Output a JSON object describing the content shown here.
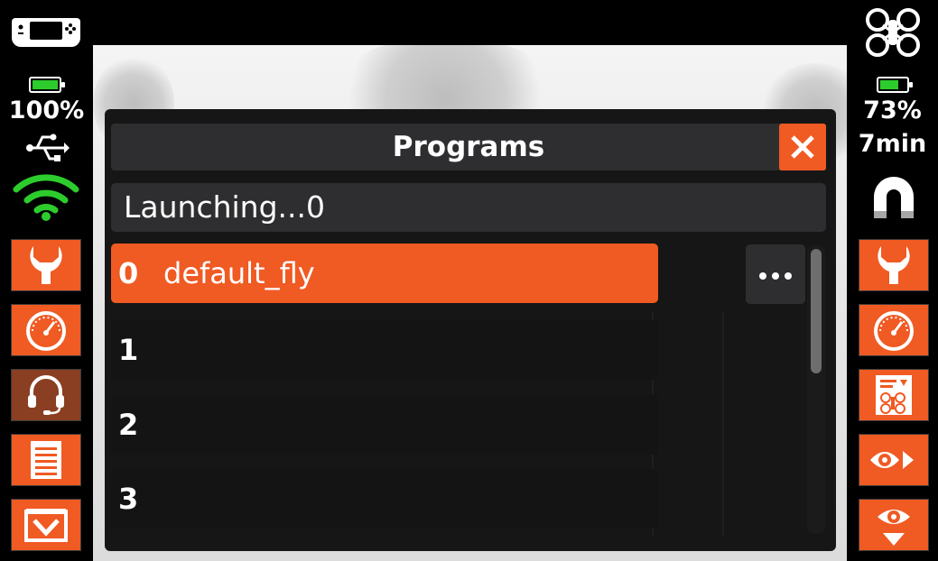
{
  "left_bar": {
    "controller_icon": "gamepad-icon",
    "battery_percent": "100%",
    "battery_level": 1.0,
    "usb_icon": "usb-icon",
    "wifi_icon": "wifi-icon",
    "buttons": [
      "wrench-icon",
      "gauge-icon",
      "headset-icon",
      "document-icon",
      "download-icon"
    ]
  },
  "right_bar": {
    "drone_icon": "drone-icon",
    "battery_percent": "73%",
    "battery_level": 0.73,
    "flight_time": "7min",
    "magnet_icon": "magnet-icon",
    "buttons": [
      "wrench-icon",
      "gauge-icon",
      "drone-program-icon",
      "eye-forward-icon",
      "eye-down-icon"
    ]
  },
  "dialog": {
    "title": "Programs",
    "close_icon": "close-icon",
    "status": "Launching...0",
    "more_icon": "ellipsis-icon",
    "programs": [
      {
        "num": "0",
        "name": "default_fly",
        "selected": true
      },
      {
        "num": "1",
        "name": "",
        "selected": false
      },
      {
        "num": "2",
        "name": "",
        "selected": false
      },
      {
        "num": "3",
        "name": "",
        "selected": false
      }
    ]
  },
  "colors": {
    "accent": "#f05a23",
    "battery_green": "#2dcc2d",
    "wifi_green": "#2dcc2d",
    "panel": "#161616",
    "bar": "#2e2e30"
  }
}
